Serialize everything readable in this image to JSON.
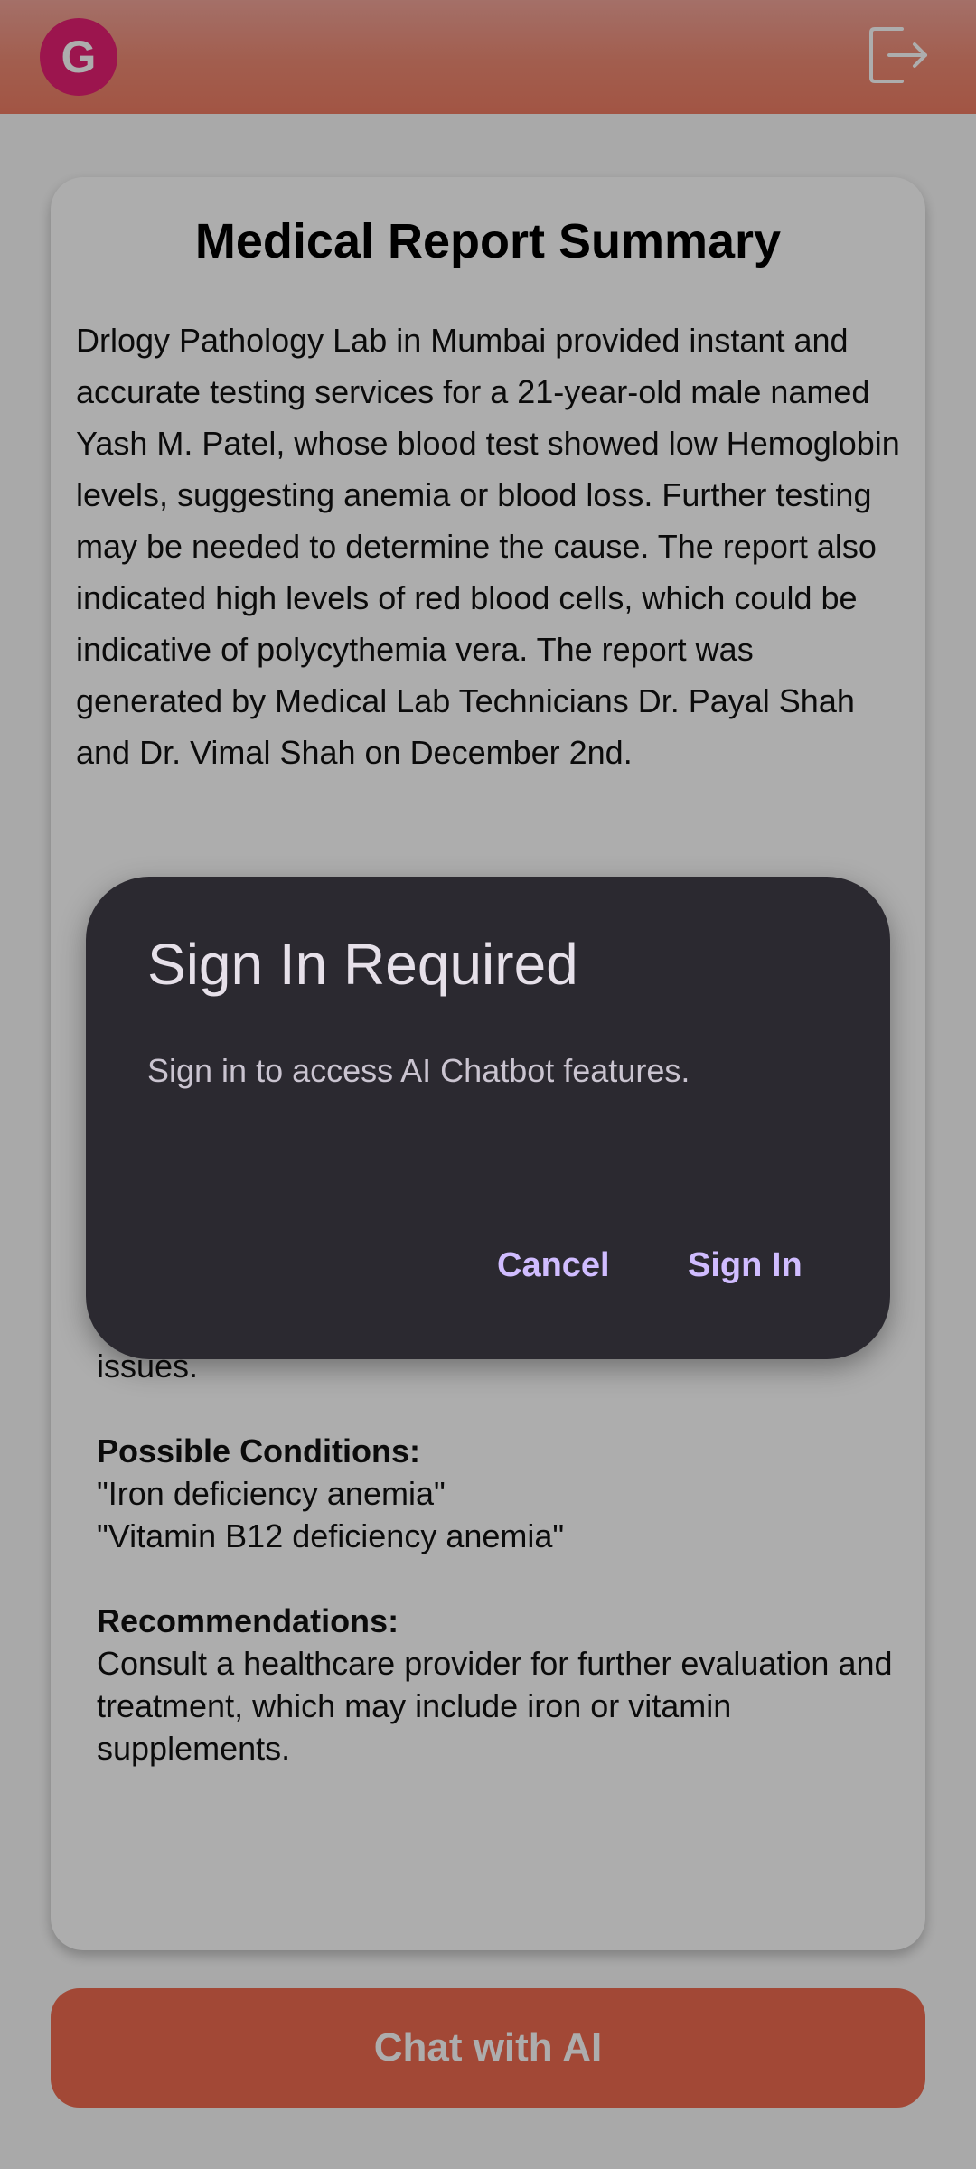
{
  "header": {
    "avatar_initial": "G",
    "logout_icon": "logout-icon"
  },
  "report": {
    "title": "Medical Report Summary",
    "summary": "Drlogy Pathology Lab in Mumbai provided instant and accurate testing services for a 21-year-old male named Yash M. Patel, whose blood test showed low Hemoglobin levels, suggesting anemia or blood loss. Further testing may be needed to determine the cause. The report also indicated high levels of red blood cells, which could be indicative of polycythemia vera. The report was generated by Medical Lab Technicians Dr. Payal Shah and Dr. Vimal Shah on December 2nd.",
    "partial_text": "which may lead to fatigue, weakness, and other health issues.",
    "conditions_heading": "Possible Conditions:",
    "conditions": [
      "\"Iron deficiency anemia\"",
      "\"Vitamin B12 deficiency anemia\""
    ],
    "recommendations_heading": "Recommendations:",
    "recommendations": "Consult a healthcare provider for further evaluation and treatment, which may include iron or vitamin supplements."
  },
  "chat_button_label": "Chat with AI",
  "dialog": {
    "title": "Sign In Required",
    "message": "Sign in to access AI Chatbot features.",
    "cancel_label": "Cancel",
    "signin_label": "Sign In"
  },
  "colors": {
    "header": "#ef8a73",
    "avatar": "#e61f73",
    "chat_button": "#ef6a50",
    "dialog_bg": "#2b2930",
    "dialog_action": "#d0bcff"
  }
}
